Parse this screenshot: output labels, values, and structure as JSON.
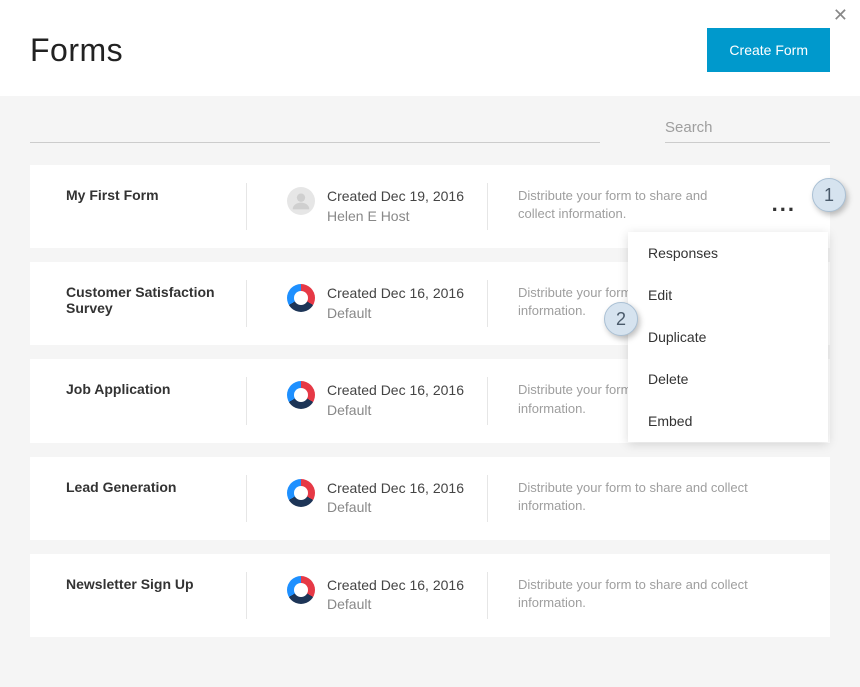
{
  "header": {
    "title": "Forms",
    "create_label": "Create Form"
  },
  "search": {
    "placeholder": "Search"
  },
  "description": "Distribute your form to share and collect information.",
  "rows": [
    {
      "name": "My First Form",
      "created": "Created Dec 19, 2016",
      "author": "Helen E Host",
      "avatar": "user"
    },
    {
      "name": "Customer Satisfaction Survey",
      "created": "Created Dec 16, 2016",
      "author": "Default",
      "avatar": "color"
    },
    {
      "name": "Job Application",
      "created": "Created Dec 16, 2016",
      "author": "Default",
      "avatar": "color"
    },
    {
      "name": "Lead Generation",
      "created": "Created Dec 16, 2016",
      "author": "Default",
      "avatar": "color"
    },
    {
      "name": "Newsletter Sign Up",
      "created": "Created Dec 16, 2016",
      "author": "Default",
      "avatar": "color"
    }
  ],
  "menu": {
    "items": [
      "Responses",
      "Edit",
      "Duplicate",
      "Delete",
      "Embed"
    ]
  },
  "callouts": {
    "one": "1",
    "two": "2"
  }
}
